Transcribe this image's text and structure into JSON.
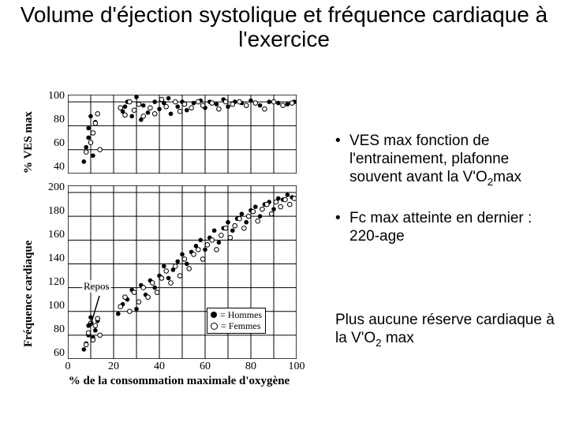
{
  "title": "Volume d'éjection systolique et fréquence cardiaque à l'exercice",
  "chart_data": [
    {
      "type": "scatter",
      "title": "",
      "ylabel": "% VES max",
      "xlabel": "",
      "xlim": [
        0,
        100
      ],
      "ylim": [
        40,
        106
      ],
      "yticks": [
        40,
        60,
        80,
        100
      ],
      "grid": true,
      "series": [
        {
          "name": "Hommes",
          "marker": "filled",
          "points": [
            [
              7,
              50
            ],
            [
              8,
              62
            ],
            [
              9,
              70
            ],
            [
              9,
              78
            ],
            [
              10,
              88
            ],
            [
              11,
              55
            ],
            [
              12,
              83
            ],
            [
              24,
              92
            ],
            [
              25,
              96
            ],
            [
              26,
              100
            ],
            [
              28,
              88
            ],
            [
              30,
              104
            ],
            [
              32,
              85
            ],
            [
              33,
              97
            ],
            [
              35,
              91
            ],
            [
              38,
              100
            ],
            [
              40,
              94
            ],
            [
              42,
              99
            ],
            [
              44,
              103
            ],
            [
              45,
              90
            ],
            [
              48,
              96
            ],
            [
              50,
              100
            ],
            [
              52,
              93
            ],
            [
              55,
              99
            ],
            [
              58,
              101
            ],
            [
              60,
              95
            ],
            [
              62,
              100
            ],
            [
              65,
              98
            ],
            [
              68,
              102
            ],
            [
              70,
              96
            ],
            [
              73,
              100
            ],
            [
              76,
              99
            ],
            [
              80,
              101
            ],
            [
              84,
              97
            ],
            [
              88,
              100
            ],
            [
              92,
              99
            ],
            [
              96,
              98
            ],
            [
              99,
              100
            ]
          ]
        },
        {
          "name": "Femmes",
          "marker": "open",
          "points": [
            [
              8,
              58
            ],
            [
              10,
              66
            ],
            [
              11,
              74
            ],
            [
              12,
              82
            ],
            [
              13,
              90
            ],
            [
              14,
              60
            ],
            [
              23,
              95
            ],
            [
              25,
              89
            ],
            [
              27,
              100
            ],
            [
              29,
              93
            ],
            [
              31,
              98
            ],
            [
              33,
              88
            ],
            [
              36,
              95
            ],
            [
              38,
              90
            ],
            [
              41,
              102
            ],
            [
              43,
              96
            ],
            [
              47,
              100
            ],
            [
              49,
              92
            ],
            [
              51,
              98
            ],
            [
              54,
              95
            ],
            [
              57,
              100
            ],
            [
              59,
              97
            ],
            [
              63,
              99
            ],
            [
              66,
              94
            ],
            [
              69,
              100
            ],
            [
              72,
              98
            ],
            [
              75,
              100
            ],
            [
              78,
              97
            ],
            [
              82,
              99
            ],
            [
              86,
              94
            ],
            [
              90,
              100
            ],
            [
              94,
              97
            ],
            [
              98,
              99
            ]
          ]
        }
      ]
    },
    {
      "type": "scatter",
      "title": "",
      "ylabel": "Fréquence cardiaque",
      "xlabel": "% de la consommation maximale d'oxygène",
      "xlim": [
        0,
        100
      ],
      "ylim": [
        60,
        206
      ],
      "yticks": [
        60,
        80,
        100,
        120,
        140,
        160,
        180,
        200
      ],
      "xticks": [
        0,
        20,
        40,
        60,
        80,
        100
      ],
      "grid": true,
      "annotations": {
        "repos": "Repos"
      },
      "legend": {
        "hommes": "= Hommes",
        "femmes": "= Femmes"
      },
      "series": [
        {
          "name": "Hommes",
          "marker": "filled",
          "points": [
            [
              7,
              68
            ],
            [
              8,
              73
            ],
            [
              9,
              80
            ],
            [
              9,
              88
            ],
            [
              10,
              95
            ],
            [
              11,
              78
            ],
            [
              12,
              84
            ],
            [
              13,
              92
            ],
            [
              22,
              98
            ],
            [
              24,
              106
            ],
            [
              26,
              110
            ],
            [
              28,
              118
            ],
            [
              30,
              102
            ],
            [
              32,
              122
            ],
            [
              34,
              114
            ],
            [
              36,
              126
            ],
            [
              38,
              120
            ],
            [
              40,
              130
            ],
            [
              42,
              138
            ],
            [
              44,
              128
            ],
            [
              46,
              135
            ],
            [
              48,
              142
            ],
            [
              50,
              148
            ],
            [
              52,
              140
            ],
            [
              54,
              150
            ],
            [
              56,
              155
            ],
            [
              58,
              160
            ],
            [
              60,
              152
            ],
            [
              62,
              162
            ],
            [
              64,
              168
            ],
            [
              66,
              158
            ],
            [
              68,
              170
            ],
            [
              70,
              175
            ],
            [
              72,
              168
            ],
            [
              74,
              178
            ],
            [
              76,
              182
            ],
            [
              78,
              175
            ],
            [
              80,
              185
            ],
            [
              82,
              188
            ],
            [
              84,
              180
            ],
            [
              86,
              190
            ],
            [
              88,
              192
            ],
            [
              90,
              186
            ],
            [
              92,
              195
            ],
            [
              94,
              194
            ],
            [
              96,
              198
            ],
            [
              98,
              196
            ]
          ]
        },
        {
          "name": "Femmes",
          "marker": "open",
          "points": [
            [
              8,
              72
            ],
            [
              9,
              82
            ],
            [
              10,
              90
            ],
            [
              11,
              76
            ],
            [
              12,
              88
            ],
            [
              13,
              94
            ],
            [
              14,
              80
            ],
            [
              23,
              104
            ],
            [
              25,
              112
            ],
            [
              27,
              100
            ],
            [
              29,
              116
            ],
            [
              31,
              108
            ],
            [
              33,
              120
            ],
            [
              35,
              112
            ],
            [
              37,
              124
            ],
            [
              39,
              116
            ],
            [
              41,
              128
            ],
            [
              43,
              134
            ],
            [
              45,
              124
            ],
            [
              47,
              138
            ],
            [
              49,
              130
            ],
            [
              51,
              144
            ],
            [
              53,
              136
            ],
            [
              55,
              148
            ],
            [
              57,
              152
            ],
            [
              59,
              144
            ],
            [
              61,
              156
            ],
            [
              63,
              160
            ],
            [
              65,
              152
            ],
            [
              67,
              164
            ],
            [
              69,
              170
            ],
            [
              71,
              162
            ],
            [
              73,
              172
            ],
            [
              75,
              178
            ],
            [
              77,
              170
            ],
            [
              79,
              180
            ],
            [
              81,
              184
            ],
            [
              83,
              176
            ],
            [
              85,
              186
            ],
            [
              87,
              190
            ],
            [
              89,
              182
            ],
            [
              91,
              192
            ],
            [
              93,
              188
            ],
            [
              95,
              194
            ],
            [
              97,
              190
            ],
            [
              99,
              195
            ]
          ]
        }
      ]
    }
  ],
  "bullets": {
    "b1_pre": "VES max fonction de l'entrainement, plafonne souvent avant la V'O",
    "b1_sub": "2",
    "b1_post": "max",
    "b2": "Fc max atteinte en dernier : 220-age"
  },
  "conclusion": {
    "pre": "Plus aucune réserve cardiaque à la V'O",
    "sub": "2",
    "post": " max"
  }
}
